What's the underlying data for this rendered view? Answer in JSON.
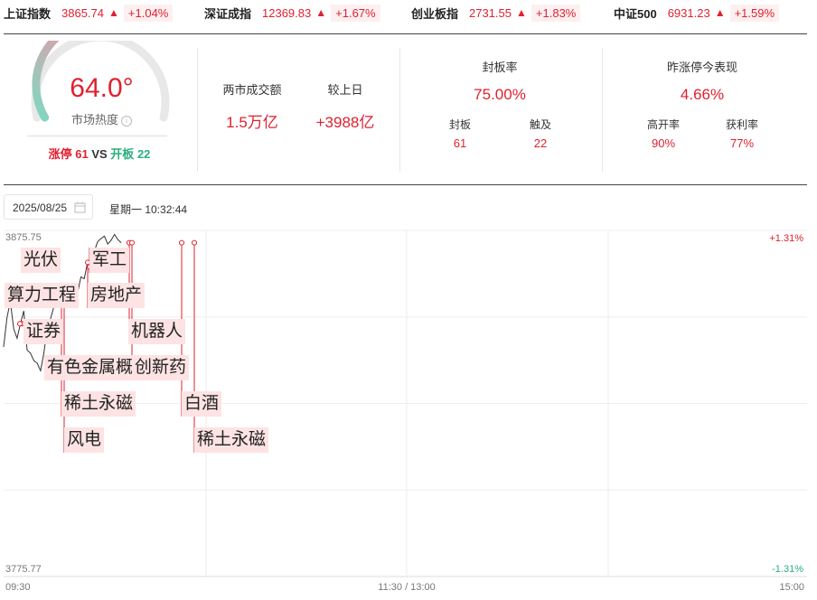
{
  "indices": [
    {
      "name": "上证指数",
      "value": "3865.74",
      "arrow": "▲",
      "pct": "+1.04%"
    },
    {
      "name": "深证成指",
      "value": "12369.83",
      "arrow": "▲",
      "pct": "+1.67%"
    },
    {
      "name": "创业板指",
      "value": "2731.55",
      "arrow": "▲",
      "pct": "+1.83%"
    },
    {
      "name": "中证500",
      "value": "6931.23",
      "arrow": "▲",
      "pct": "+1.59%"
    }
  ],
  "heat": {
    "value": "64.0°",
    "value_num": 64.0,
    "label": "市场热度",
    "limit_up_label": "涨停",
    "limit_up_count": "61",
    "vs": "VS",
    "open_label": "开板",
    "open_count": "22"
  },
  "turnover": {
    "label": "两市成交额",
    "value": "1.5万亿",
    "compare_label": "较上日",
    "compare_value": "+3988亿"
  },
  "seal": {
    "label": "封板率",
    "value": "75.00%",
    "sealed_label": "封板",
    "sealed_value": "61",
    "touched_label": "触及",
    "touched_value": "22"
  },
  "yesterday": {
    "label": "昨涨停今表现",
    "value": "4.66%",
    "high_open_label": "高开率",
    "high_open_value": "90%",
    "profit_label": "获利率",
    "profit_value": "77%"
  },
  "date": "2025/08/25",
  "datetime": "星期一  10:32:44",
  "chart_data": {
    "type": "line",
    "y_max": 3875.75,
    "y_min": 3775.77,
    "pct_max": "+1.31%",
    "pct_min": "-1.31%",
    "x_labels": [
      "09:30",
      "11:30 / 13:00",
      "15:00"
    ],
    "series": [
      {
        "values": [
          3842.1,
          3850.5,
          3855.2,
          3847.3,
          3844.6,
          3848.8,
          3852.5,
          3841.2,
          3840.3,
          3838.1,
          3837.4,
          3835.2,
          3840.4,
          3847.8,
          3850.3,
          3853.9,
          3855.3,
          3858.4,
          3857.1,
          3859.3,
          3858.0,
          3860.1,
          3857.6,
          3862.3,
          3861.8,
          3866.5,
          3865.2,
          3869.8,
          3872.5,
          3873.4,
          3874.1,
          3871.8,
          3872.9,
          3874.6,
          3873.1,
          3872.2
        ]
      }
    ],
    "sector_tags": [
      {
        "label": "光伏"
      },
      {
        "label": "军工"
      },
      {
        "label": "算力工程"
      },
      {
        "label": "房地产"
      },
      {
        "label": "证券"
      },
      {
        "label": "机器人"
      },
      {
        "label": "有色金属概"
      },
      {
        "label": "创新药"
      },
      {
        "label": "稀土永磁"
      },
      {
        "label": "白酒"
      },
      {
        "label": "风电"
      },
      {
        "label": "稀土永磁"
      }
    ]
  }
}
